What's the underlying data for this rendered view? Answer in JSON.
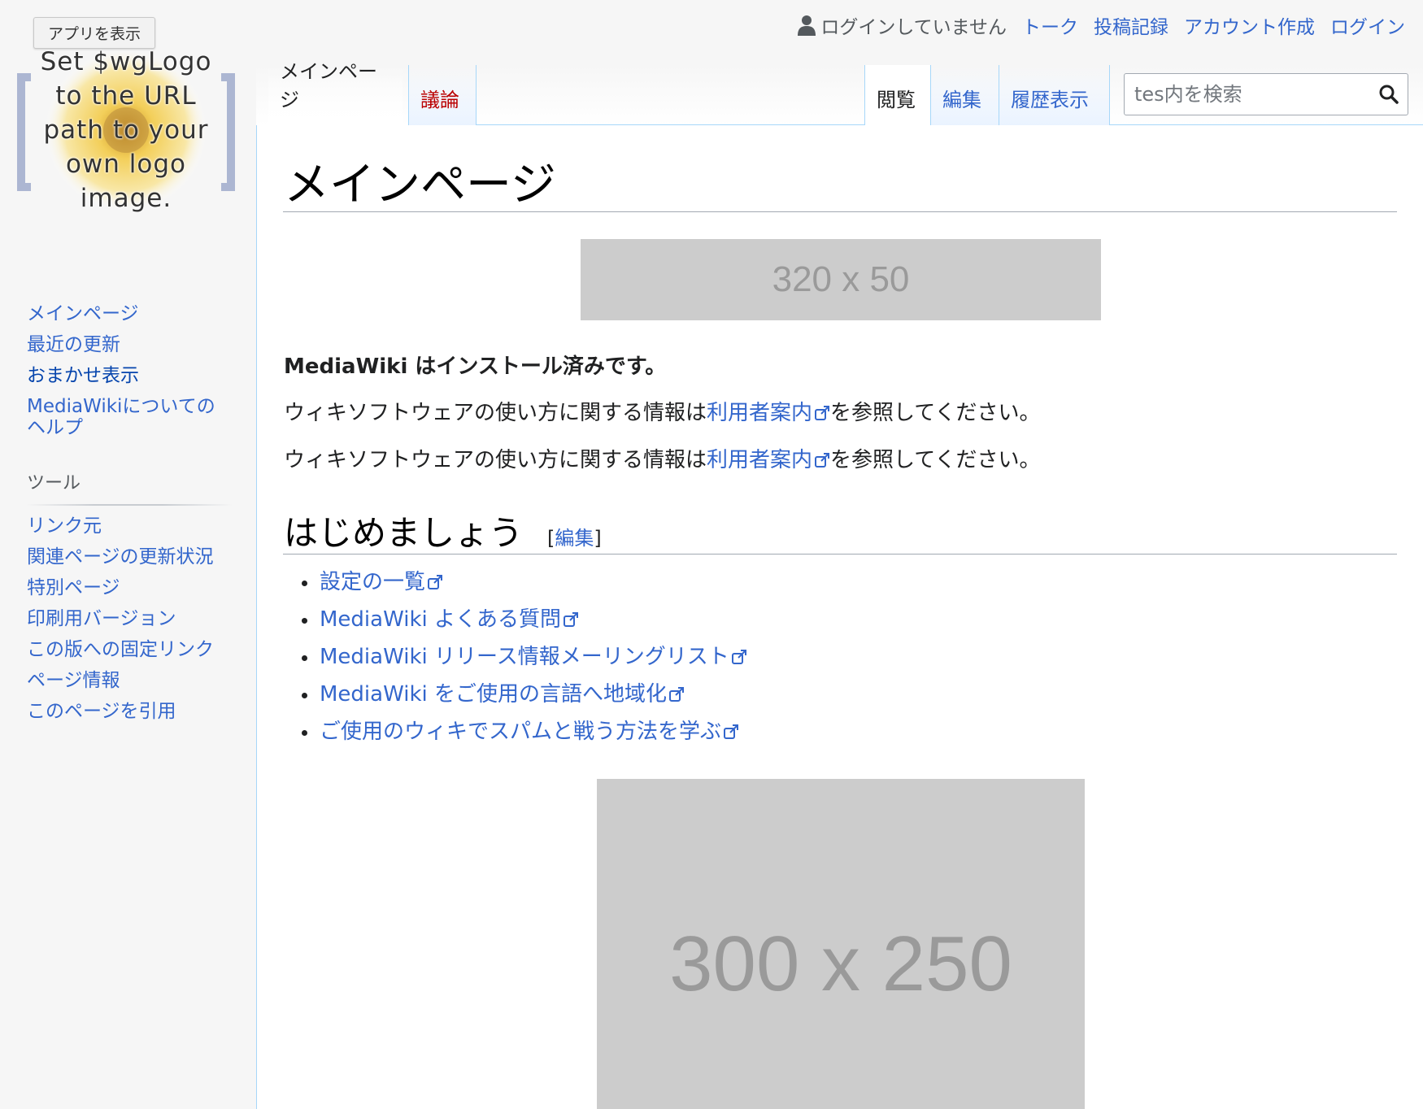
{
  "app_button": {
    "label": "アプリを表示"
  },
  "logo": {
    "lines": [
      "Set $wgLogo",
      "to the URL",
      "path to your",
      "own logo",
      "image."
    ]
  },
  "personal_tools": {
    "anon_label": "ログインしていません",
    "links": [
      "トーク",
      "投稿記録",
      "アカウント作成",
      "ログイン"
    ]
  },
  "namespace_tabs": [
    {
      "label": "メインページ",
      "selected": true
    },
    {
      "label": "議論",
      "selected": false,
      "new": true
    }
  ],
  "view_tabs": [
    {
      "label": "閲覧",
      "selected": true
    },
    {
      "label": "編集",
      "selected": false
    },
    {
      "label": "履歴表示",
      "selected": false
    }
  ],
  "search": {
    "placeholder": "tes内を検索",
    "icon": "search-icon"
  },
  "sidebar": {
    "navigation": [
      {
        "label": "メインページ"
      },
      {
        "label": "最近の更新"
      },
      {
        "label": "おまかせ表示"
      },
      {
        "label": "MediaWikiについての"
      },
      {
        "label": "ヘルプ"
      }
    ],
    "tools_heading": "ツール",
    "tools": [
      {
        "label": "リンク元"
      },
      {
        "label": "関連ページの更新状況"
      },
      {
        "label": "特別ページ"
      },
      {
        "label": "印刷用バージョン"
      },
      {
        "label": "この版への固定リンク"
      },
      {
        "label": "ページ情報"
      },
      {
        "label": "このページを引用"
      }
    ]
  },
  "content": {
    "title": "メインページ",
    "ad_top": "320 x 50",
    "intro_bold": "MediaWiki はインストール済みです。",
    "para1": {
      "before": "ウィキソフトウェアの使い方に関する情報は",
      "link": "利用者案内",
      "after": "を参照してください。"
    },
    "para2": {
      "before": "ウィキソフトウェアの使い方に関する情報は",
      "link": "利用者案内",
      "after": "を参照してください。"
    },
    "section_heading": "はじめましょう",
    "edit_open": "[",
    "edit_link": "編集",
    "edit_close": "]",
    "links": [
      "設定の一覧",
      "MediaWiki よくある質問",
      "MediaWiki リリース情報メーリングリスト",
      "MediaWiki をご使用の言語へ地域化",
      "ご使用のウィキでスパムと戦う方法を学ぶ"
    ],
    "ad_bottom": "300 x 250"
  },
  "colors": {
    "link": "#3366cc",
    "new_link": "#ba0000",
    "tab_border": "#a7d7f9",
    "ad_bg": "#cccccc"
  }
}
